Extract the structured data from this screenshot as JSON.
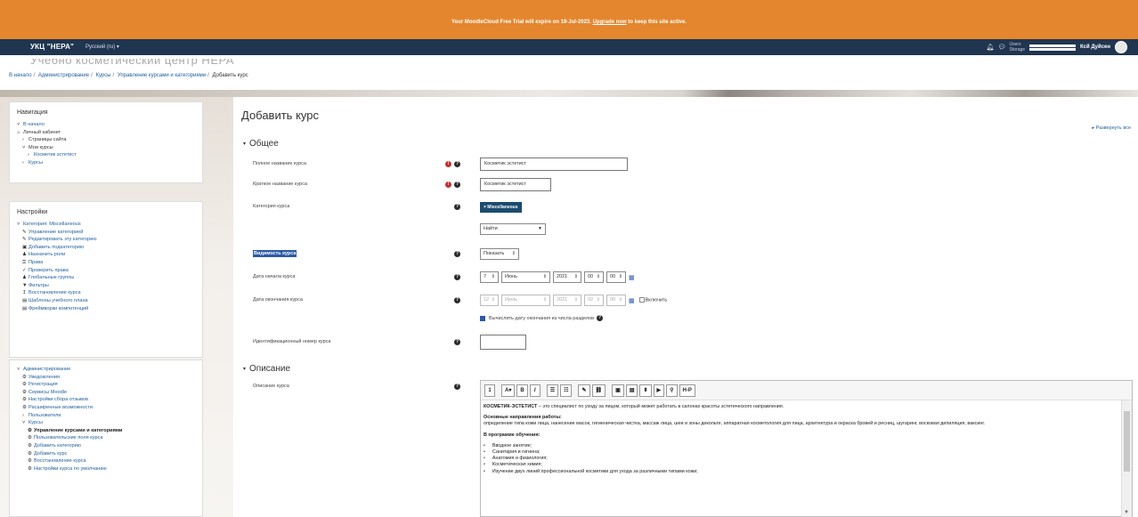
{
  "banner": {
    "text": "Your MoodleCloud Free Trial will expire on 19-Jul-2023.",
    "link": "Upgrade now",
    "after": "to keep this site active."
  },
  "navbar": {
    "brand": "УКЦ \"НЕРА\"",
    "lang": "Русский (ru) ▾",
    "users_label": "Users",
    "storage_label": "Storage",
    "user_name": "Ксй Дуйсен"
  },
  "page": {
    "ghost_title": "Учебно косметический центр НЕРА"
  },
  "breadcrumb": [
    "В начало",
    "Администрирование",
    "Курсы",
    "Управление курсами и категориями",
    "Добавить курс"
  ],
  "nav_block": {
    "title": "Навигация",
    "items": [
      {
        "label": "В начало",
        "glyph": "˅"
      },
      {
        "label": "Личный кабинет",
        "glyph": "⌂"
      },
      {
        "label": "Страницы сайта",
        "glyph": "›"
      },
      {
        "label": "Мои курсы",
        "glyph": "˅"
      },
      {
        "label": "Косметик эстетист",
        "glyph": "›"
      },
      {
        "label": "Курсы",
        "glyph": "›"
      }
    ]
  },
  "settings_block": {
    "title": "Настройки",
    "items": [
      {
        "label": "Категория: Miscellaneous",
        "glyph": "˅"
      },
      {
        "label": "Управление категорией",
        "glyph": "✎"
      },
      {
        "label": "Редактировать эту категорию",
        "glyph": "✎"
      },
      {
        "label": "Добавить подкатегорию",
        "glyph": "▣"
      },
      {
        "label": "Назначить роли",
        "glyph": "♟"
      },
      {
        "label": "Права",
        "glyph": "⚿"
      },
      {
        "label": "Проверить права",
        "glyph": "✓"
      },
      {
        "label": "Глобальные группы",
        "glyph": "♟"
      },
      {
        "label": "Фильтры",
        "glyph": "▼"
      },
      {
        "label": "Восстановление курса",
        "glyph": "↥"
      },
      {
        "label": "Шаблоны учебного плана",
        "glyph": "▤"
      },
      {
        "label": "Фреймворки компетенций",
        "glyph": "▤"
      }
    ]
  },
  "admin_block": {
    "items": [
      {
        "label": "Администрирование",
        "glyph": "˅"
      },
      {
        "label": "Уведомления",
        "glyph": "⚙"
      },
      {
        "label": "Регистрация",
        "glyph": "⚙"
      },
      {
        "label": "Сервисы Moodle",
        "glyph": "⚙"
      },
      {
        "label": "Настройки сбора отзывов",
        "glyph": "⚙"
      },
      {
        "label": "Расширенные возможности",
        "glyph": "⚙"
      },
      {
        "label": "Пользователи",
        "glyph": "›"
      },
      {
        "label": "Курсы",
        "glyph": "˅"
      },
      {
        "label": "Управление курсами и категориями",
        "glyph": "⚙"
      },
      {
        "label": "Пользовательские поля курса",
        "glyph": "⚙"
      },
      {
        "label": "Добавить категорию",
        "glyph": "⚙"
      },
      {
        "label": "Добавить курс",
        "glyph": "⚙"
      },
      {
        "label": "Восстановление курса",
        "glyph": "⚙"
      },
      {
        "label": "Настройки курса по умолчанию",
        "glyph": "⚙"
      }
    ]
  },
  "main": {
    "title": "Добавить курс",
    "expand_all": "▸ Развернуть все",
    "section_general": "Общее",
    "section_description": "Описание",
    "fields": {
      "fullname_label": "Полное название курса",
      "fullname_value": "Косметик эстетист",
      "shortname_label": "Краткое название курса",
      "shortname_value": "Косметик эстетист",
      "category_label": "Категория курса",
      "category_value": "× Miscellaneous",
      "category_search": "Найти",
      "visibility_label": "Видимость курса",
      "visibility_value": "Показать",
      "start_label": "Дата начала курса",
      "start_day": "7",
      "start_month": "Июнь",
      "start_year": "2021",
      "start_hour": "00",
      "start_min": "00",
      "end_label": "Дата окончания курса",
      "end_day": "12",
      "end_month": "Июль",
      "end_year": "2021",
      "end_hour": "02",
      "end_min": "00",
      "end_enable": "Включить",
      "calc_end": "Вычислить дату окончания из числа разделов",
      "idnumber_label": "Идентификационный номер курса",
      "summary_label": "Описание курса"
    },
    "editor": {
      "toolbar": [
        "1",
        "A▾",
        "B",
        "I",
        "☰",
        "☷",
        "✎",
        "⛓",
        "▣",
        "▤",
        "⬍",
        "▶",
        "⚲",
        "H-P"
      ],
      "kw": "КОСМЕТИК-ЭСТЕТИСТ",
      "intro": " – это специалист по уходу за лицом, который может работать в салонах красоты эстетического направления.",
      "h1": "Основные направления работы:",
      "p1": "определение типа кожи лица, нанесение масок, гигиеническая чистка, массаж лица, шеи и зоны декольте, аппаратная косметология для лица, архитектура и окраска бровей и ресниц, шугаринг, восковая депиляция, ваксинг.",
      "h2": "В программе обучения:",
      "list": [
        "Вводное занятие;",
        "Санитария и гигиена;",
        "Анатомия и физиология;",
        "Косметическая химия;",
        "Изучение двух линий профессиональной косметики для ухода за различными типами кожи;"
      ]
    }
  }
}
